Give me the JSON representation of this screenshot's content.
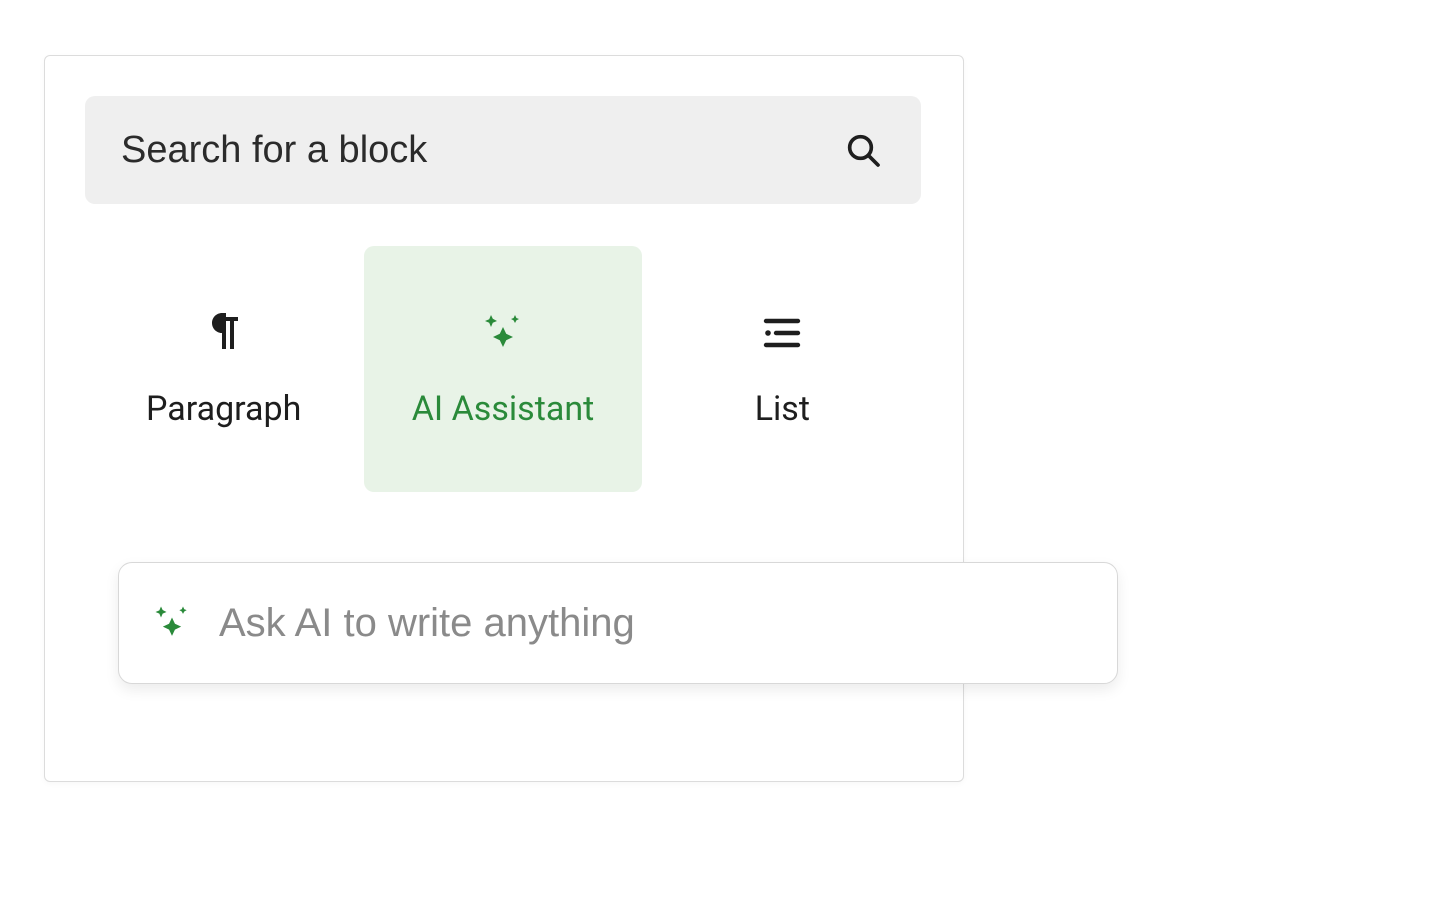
{
  "search": {
    "placeholder": "Search for a block",
    "value": ""
  },
  "blocks": [
    {
      "label": "Paragraph"
    },
    {
      "label": "AI Assistant"
    },
    {
      "label": "List"
    }
  ],
  "ai_prompt": {
    "placeholder": "Ask AI to write anything",
    "value": ""
  },
  "colors": {
    "ai_green": "#2a8a3a",
    "ai_bg": "#e8f3e7"
  }
}
